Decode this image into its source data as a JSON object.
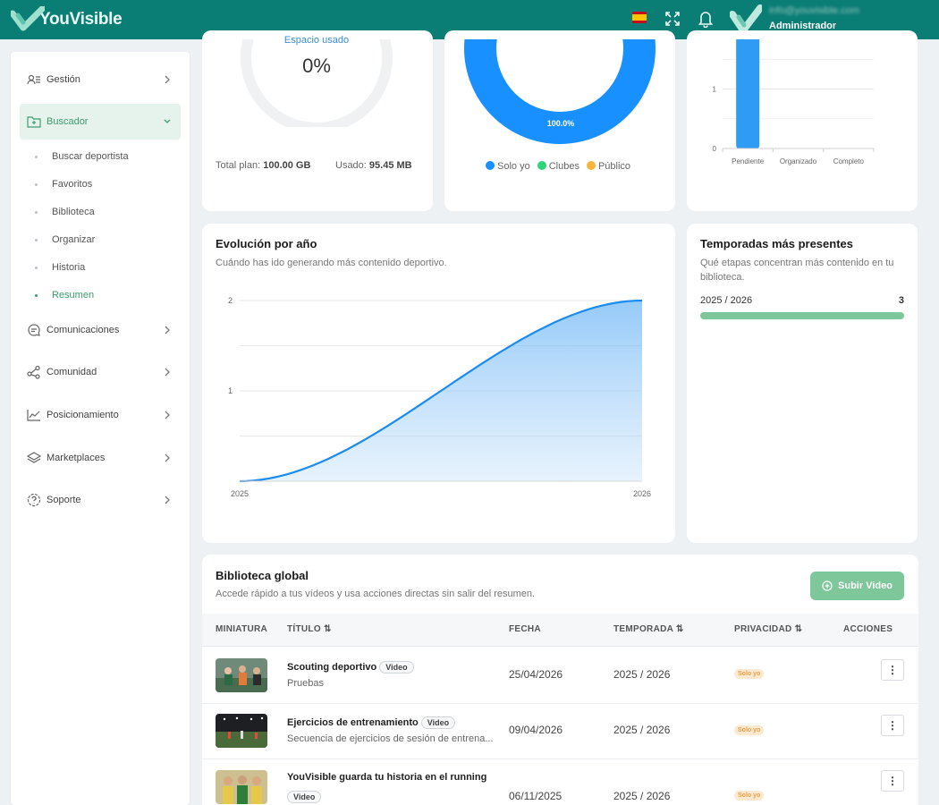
{
  "header": {
    "brand": "YouVisible",
    "user_email": "info@youvisible.com",
    "user_role": "Administrador",
    "accent": "#0a7d74"
  },
  "sidebar": {
    "items": [
      {
        "label": "Gestión",
        "icon": "user-list-icon"
      },
      {
        "label": "Buscador",
        "icon": "folder-search-icon"
      },
      {
        "label": "Comunicaciones",
        "icon": "chat-icon"
      },
      {
        "label": "Comunidad",
        "icon": "share-nodes-icon"
      },
      {
        "label": "Posicionamiento",
        "icon": "line-chart-icon"
      },
      {
        "label": "Marketplaces",
        "icon": "layers-icon"
      },
      {
        "label": "Soporte",
        "icon": "help-icon"
      }
    ],
    "subitems": [
      "Buscar deportista",
      "Favoritos",
      "Biblioteca",
      "Organizar",
      "Historia",
      "Resumen"
    ]
  },
  "storage": {
    "label": "Espacio usado",
    "percent": "0%",
    "plan_label": "Total plan:",
    "plan_value": "100.00 GB",
    "used_label": "Usado:",
    "used_value": "95.45 MB"
  },
  "privacy_chart": {
    "center_value": "100.0%",
    "legend": [
      "Solo yo",
      "Clubes",
      "Público"
    ],
    "colors": [
      "#1890ff",
      "#2ed47a",
      "#f9b43c"
    ]
  },
  "status_chart": {
    "categories": [
      "Pendiente",
      "Organizado",
      "Completo"
    ],
    "y_ticks": [
      "0",
      "1"
    ]
  },
  "evolution": {
    "title": "Evolución por año",
    "subtitle": "Cuándo has ido generando más contenido deportivo.",
    "y_ticks": [
      "1",
      "2"
    ],
    "x_ticks": [
      "2025",
      "2026"
    ]
  },
  "seasons": {
    "title": "Temporadas más presentes",
    "subtitle": "Qué etapas concentran más contenido en tu biblioteca.",
    "rows": [
      {
        "label": "2025 / 2026",
        "count": "3"
      }
    ]
  },
  "library": {
    "title": "Biblioteca global",
    "subtitle": "Accede rápido a tus vídeos y usa acciones directas sin salir del resumen.",
    "upload_label": "Subir Video",
    "columns": [
      "MINIATURA",
      "TÍTULO",
      "FECHA",
      "TEMPORADA",
      "PRIVACIDAD",
      "ACCIONES"
    ],
    "rows": [
      {
        "title": "Scouting deportivo",
        "type": "Video",
        "desc": "Pruebas",
        "date": "25/04/2026",
        "season": "2025 / 2026",
        "privacy": "Solo yo"
      },
      {
        "title": "Ejercicios de entrenamiento",
        "type": "Video",
        "desc": "Secuencia de ejercicios de sesión de entrena...",
        "date": "09/04/2026",
        "season": "2025 / 2026",
        "privacy": "Solo yo"
      },
      {
        "title": "YouVisible guarda tu historia en el running",
        "type": "Video",
        "desc": "",
        "date": "06/11/2025",
        "season": "2025 / 2026",
        "privacy": "Solo yo"
      }
    ]
  },
  "chart_data": [
    {
      "type": "pie",
      "categories": [
        "Solo yo",
        "Clubes",
        "Público"
      ],
      "values": [
        100.0,
        0,
        0
      ],
      "data_labels": [
        "100.0%"
      ]
    },
    {
      "type": "bar",
      "categories": [
        "Pendiente",
        "Organizado",
        "Completo"
      ],
      "values": [
        2,
        0,
        0
      ],
      "ylim": [
        0,
        2
      ]
    },
    {
      "type": "area",
      "title": "Evolución por año",
      "x": [
        "2025",
        "2026"
      ],
      "values": [
        0,
        2
      ],
      "ylim": [
        0,
        2
      ],
      "grid": true
    },
    {
      "type": "bar",
      "title": "Temporadas más presentes",
      "categories": [
        "2025 / 2026"
      ],
      "values": [
        3
      ]
    }
  ]
}
